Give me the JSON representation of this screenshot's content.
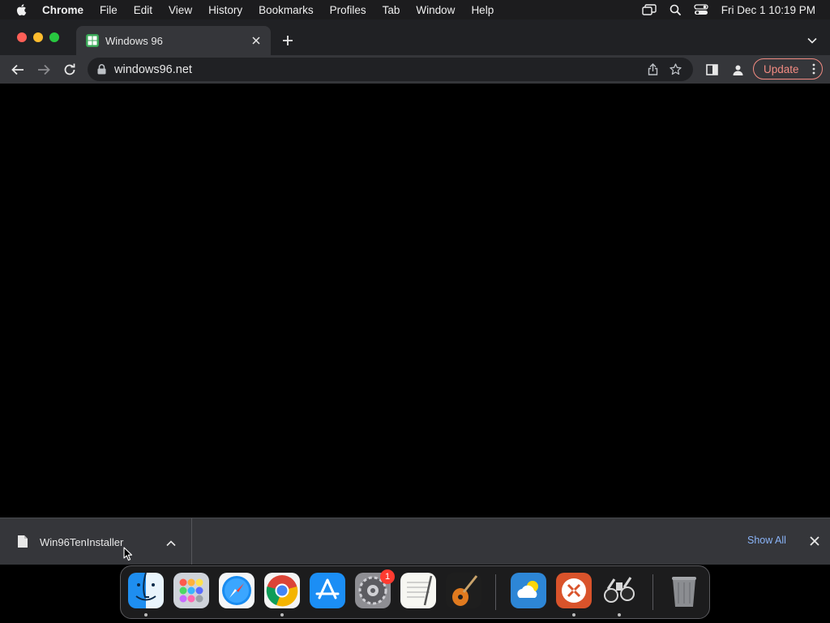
{
  "menubar": {
    "items": [
      "Chrome",
      "File",
      "Edit",
      "View",
      "History",
      "Bookmarks",
      "Profiles",
      "Tab",
      "Window",
      "Help"
    ],
    "clock": "Fri Dec 1  10:19 PM"
  },
  "tab": {
    "title": "Windows 96"
  },
  "omnibox": {
    "url": "windows96.net"
  },
  "toolbar": {
    "update_label": "Update"
  },
  "downloads": {
    "item_name": "Win96TenInstaller",
    "show_all_label": "Show All"
  },
  "dock": {
    "settings_badge": "1",
    "apps": [
      "finder-icon",
      "launchpad-icon",
      "safari-icon",
      "chrome-icon",
      "app-store-icon",
      "system-settings-icon",
      "textedit-icon",
      "garageband-icon",
      "weather-icon",
      "remote-desktop-icon",
      "binoculars-icon",
      "trash-icon"
    ]
  },
  "colors": {
    "tab_strip": "#202124",
    "toolbar": "#35363a",
    "page_background": "#000000",
    "update_accent": "#f28b82",
    "link_blue": "#8ab4f8"
  }
}
